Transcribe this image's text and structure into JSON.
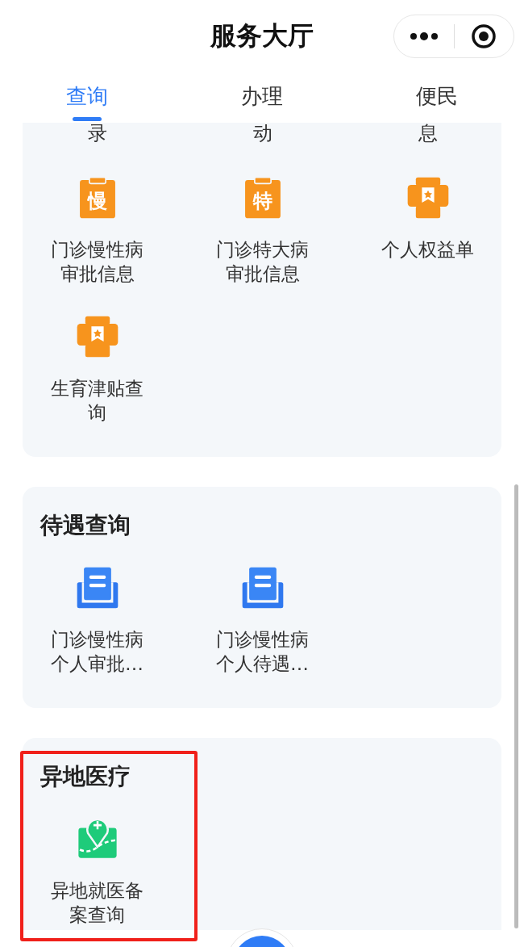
{
  "header": {
    "title": "服务大厅"
  },
  "tabs": [
    {
      "label": "查询",
      "selected": true
    },
    {
      "label": "办理",
      "selected": false
    },
    {
      "label": "便民",
      "selected": false
    }
  ],
  "sections": [
    {
      "cut_labels": [
        "录",
        "动",
        "息"
      ],
      "items": [
        {
          "kind": "clipboard",
          "icon_text": "慢",
          "label": "门诊慢性病审批信息"
        },
        {
          "kind": "clipboard",
          "icon_text": "特",
          "label": "门诊特大病审批信息"
        },
        {
          "kind": "printer",
          "label": "个人权益单"
        },
        {
          "kind": "printer",
          "label": "生育津贴查询"
        }
      ]
    },
    {
      "title": "待遇查询",
      "items": [
        {
          "kind": "tray",
          "label": "门诊慢性病个人审批…"
        },
        {
          "kind": "tray",
          "label": "门诊慢性病个人待遇…"
        }
      ]
    },
    {
      "title": "异地医疗",
      "highlighted": true,
      "items": [
        {
          "kind": "map",
          "label": "异地就医备案查询"
        }
      ]
    }
  ]
}
